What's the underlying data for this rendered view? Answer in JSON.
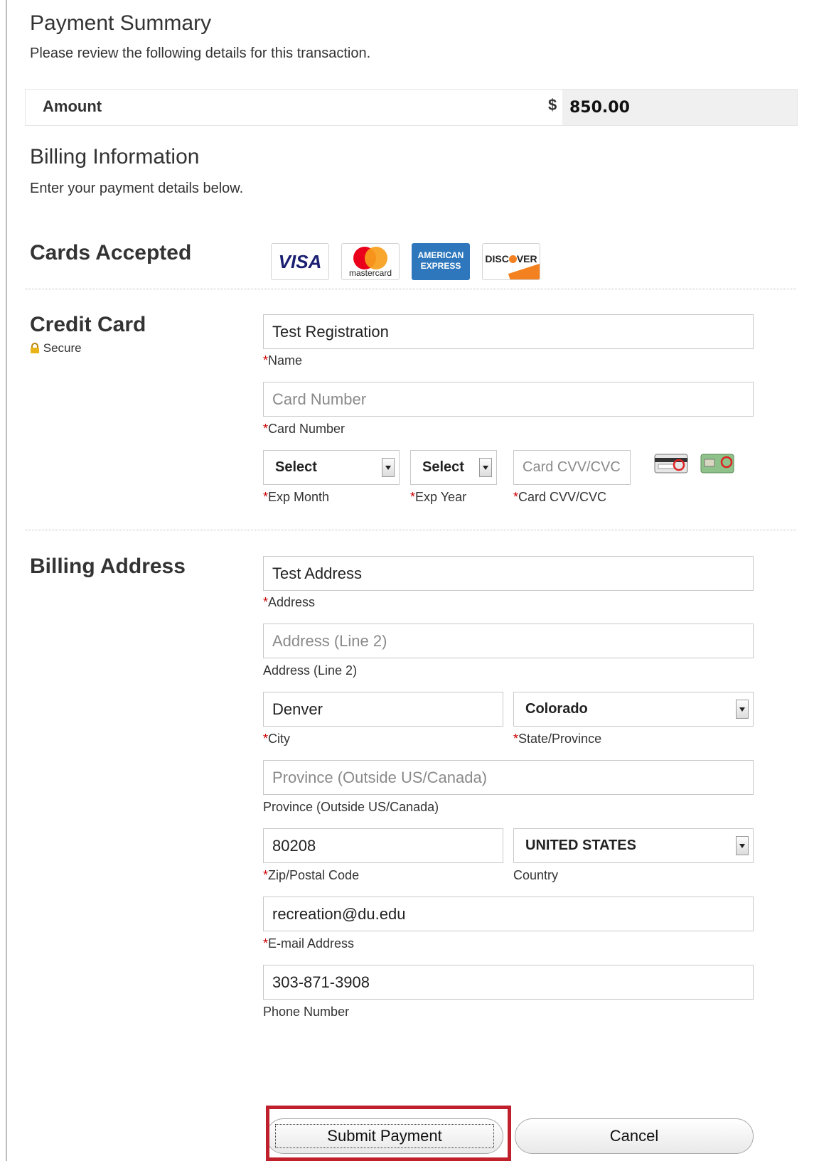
{
  "payment_summary": {
    "title": "Payment Summary",
    "subtitle": "Please review the following details for this transaction.",
    "amount_label": "Amount",
    "currency_symbol": "$",
    "amount_value": "850.00"
  },
  "billing_information": {
    "title": "Billing Information",
    "subtitle": "Enter your payment details below."
  },
  "cards_accepted": {
    "label": "Cards Accepted",
    "cards": [
      {
        "name": "visa",
        "text": "VISA"
      },
      {
        "name": "mastercard",
        "text": "mastercard"
      },
      {
        "name": "american-express",
        "text_line1": "AMERICAN",
        "text_line2": "EXPRESS"
      },
      {
        "name": "discover",
        "text_before": "DISC",
        "text_after": "VER"
      }
    ]
  },
  "credit_card": {
    "label": "Credit Card",
    "secure_text": "Secure",
    "name": {
      "value": "Test Registration",
      "required_marker": "*",
      "caption": "Name"
    },
    "card_number": {
      "value": "",
      "placeholder": "Card Number",
      "required_marker": "*",
      "caption": "Card Number"
    },
    "exp_month": {
      "selected": "Select",
      "required_marker": "*",
      "caption": "Exp Month"
    },
    "exp_year": {
      "selected": "Select",
      "required_marker": "*",
      "caption": "Exp Year"
    },
    "cvv": {
      "value": "",
      "placeholder": "Card CVV/CVC",
      "required_marker": "*",
      "caption": "Card CVV/CVC"
    }
  },
  "billing_address": {
    "label": "Billing Address",
    "address": {
      "value": "Test Address",
      "required_marker": "*",
      "caption": "Address"
    },
    "address2": {
      "value": "",
      "placeholder": "Address (Line 2)",
      "caption": "Address (Line 2)"
    },
    "city": {
      "value": "Denver",
      "required_marker": "*",
      "caption": "City"
    },
    "state": {
      "selected": "Colorado",
      "required_marker": "*",
      "caption": "State/Province"
    },
    "province": {
      "value": "",
      "placeholder": "Province (Outside US/Canada)",
      "caption": "Province (Outside US/Canada)"
    },
    "zip": {
      "value": "80208",
      "required_marker": "*",
      "caption": "Zip/Postal Code"
    },
    "country": {
      "selected": "UNITED STATES",
      "caption": "Country"
    },
    "email": {
      "value": "recreation@du.edu",
      "required_marker": "*",
      "caption": "E-mail Address"
    },
    "phone": {
      "value": "303-871-3908",
      "caption": "Phone Number"
    }
  },
  "actions": {
    "submit_label": "Submit Payment",
    "cancel_label": "Cancel"
  },
  "colors": {
    "highlight": "#c0202c",
    "required": "#cc0000",
    "visa_blue": "#1a1f71",
    "mastercard_red": "#eb001b",
    "mastercard_orange": "#f79e1b",
    "amex_blue": "#2e77bc",
    "discover_orange": "#f48120"
  },
  "icons": [
    "lock-icon",
    "chevron-down-icon",
    "card-back-cvv-icon",
    "card-front-cvv-icon"
  ]
}
